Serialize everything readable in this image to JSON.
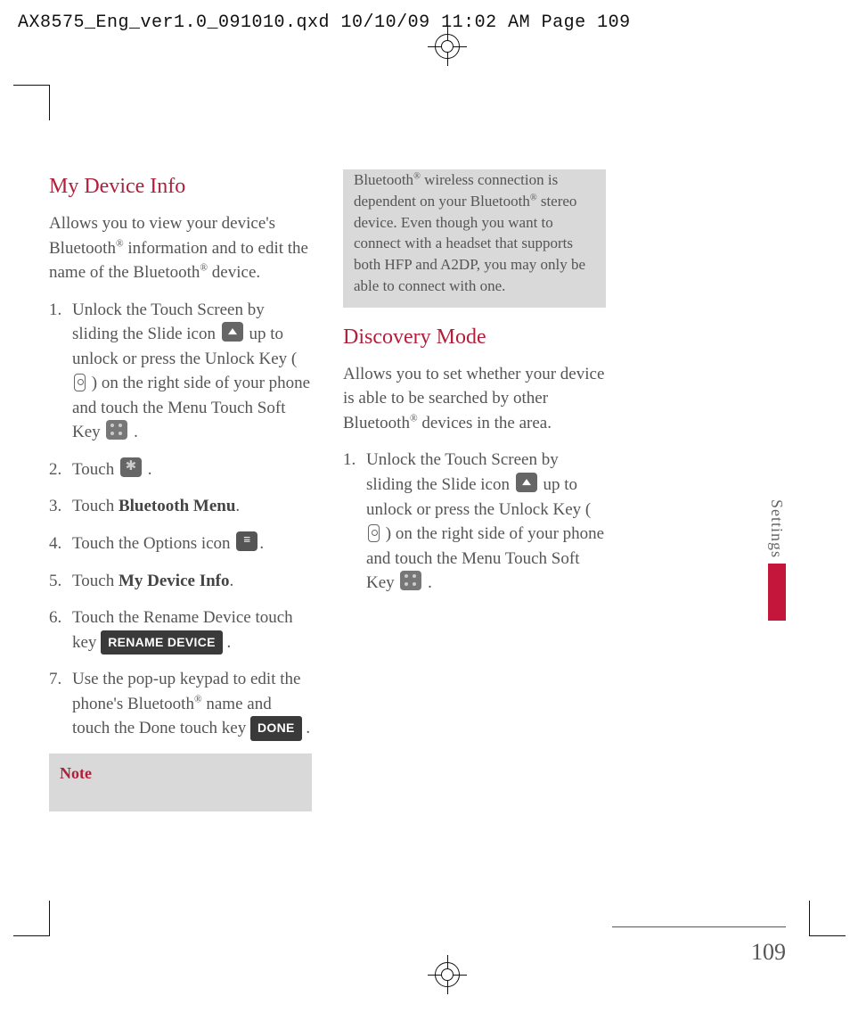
{
  "slug": "AX8575_Eng_ver1.0_091010.qxd  10/10/09  11:02 AM  Page 109",
  "page_number": "109",
  "side_tab": "Settings",
  "sections": {
    "my_device_info": {
      "heading": "My Device Info",
      "intro_a": "Allows you to view your device's Bluetooth",
      "intro_b": " information and to edit the name of the Bluetooth",
      "intro_c": " device.",
      "steps": {
        "s1a": "Unlock the Touch Screen by sliding the Slide icon ",
        "s1b": " up to unlock or press the Unlock Key ( ",
        "s1c": " ) on the right side of your phone and touch the Menu Touch Soft Key ",
        "s1d": " .",
        "s2a": "Touch ",
        "s2b": " .",
        "s3a": "Touch ",
        "s3b": "Bluetooth Menu",
        "s3c": ".",
        "s4a": "Touch the Options icon ",
        "s4b": ".",
        "s5a": "Touch ",
        "s5b": "My Device Info",
        "s5c": ".",
        "s6a": "Touch the Rename Device touch key ",
        "s6b": " .",
        "s7a": "Use the pop-up keypad to edit the phone's Bluetooth",
        "s7b": " name and touch the Done touch key ",
        "s7c": " ."
      },
      "keys": {
        "rename": "RENAME DEVICE",
        "done": "DONE"
      }
    },
    "note": {
      "heading": "Note",
      "body_a": "Bluetooth",
      "body_b": " wireless connection is dependent on your Bluetooth",
      "body_c": " stereo device. Even though you want to connect with a headset that supports both HFP and A2DP, you may only be able to connect with one."
    },
    "discovery_mode": {
      "heading": "Discovery Mode",
      "intro_a": "Allows you to set whether your device is able to be searched by other Bluetooth",
      "intro_b": " devices in the area.",
      "steps": {
        "s1a": "Unlock the Touch Screen by sliding the Slide icon ",
        "s1b": " up to unlock or press the Unlock Key ( ",
        "s1c": " ) on the right side of your phone and touch the Menu Touch Soft Key ",
        "s1d": " ."
      }
    }
  }
}
